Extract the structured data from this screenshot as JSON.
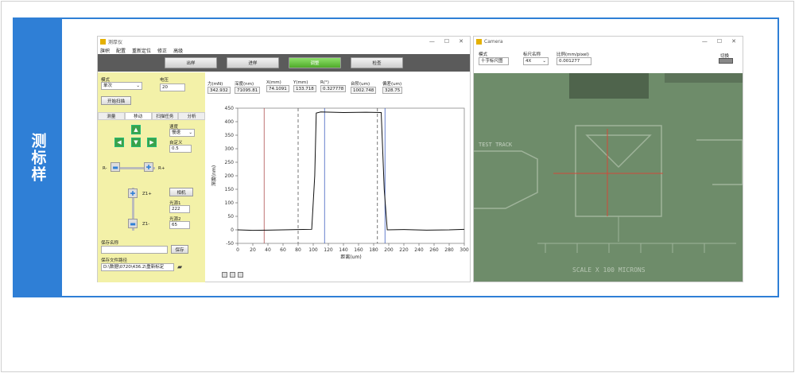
{
  "sidebar": {
    "title": "测标样"
  },
  "left_window": {
    "title": "测厚仪",
    "menu": [
      "旗帜",
      "配置",
      "重新定位",
      "修正",
      "高级"
    ],
    "toolbar": [
      "出样",
      "进样",
      "调整",
      "检查"
    ],
    "mode_label": "模式",
    "mode_value": "单次",
    "voltage_label": "电压",
    "voltage_value": "20",
    "start_scan": "开始扫描",
    "tabs": [
      "测量",
      "移动",
      "扫描任务",
      "分析"
    ],
    "speed_label": "速度",
    "speed_value": "慢速",
    "custom_label": "自定义",
    "custom_value": "0.5",
    "r_minus": "R-",
    "r_plus": "R+",
    "z_plus": "Z1+",
    "z_minus": "Z1-",
    "camera_btn": "相机",
    "light1_label": "光源1",
    "light1_value": "222",
    "light2_label": "光源2",
    "light2_value": "65",
    "save_name_label": "保存名称",
    "save_btn": "保存",
    "save_path_label": "保存文件路径",
    "save_path_value": "D:\\数据\\0720\\436.2\\重新标定",
    "readouts": [
      {
        "name": "力(mN)",
        "value": "342.932"
      },
      {
        "name": "深度(nm)",
        "value": "71095.81"
      },
      {
        "name": "X(mm)",
        "value": "74.1091"
      },
      {
        "name": "Y(mm)",
        "value": "133.718"
      },
      {
        "name": "R(°)",
        "value": "0.327778"
      },
      {
        "name": "台阶(um)",
        "value": "1002.748"
      },
      {
        "name": "偏差(um)",
        "value": "328.75"
      }
    ]
  },
  "chart_data": {
    "type": "line",
    "xlabel": "距离(um)",
    "ylabel": "深度(nm)",
    "xlim": [
      0,
      300
    ],
    "ylim": [
      -50,
      450
    ],
    "xticks": [
      0,
      20,
      40,
      60,
      80,
      100,
      120,
      140,
      160,
      180,
      200,
      220,
      240,
      260,
      280,
      300
    ],
    "yticks": [
      -50,
      0,
      50,
      100,
      150,
      200,
      250,
      300,
      350,
      400,
      450
    ],
    "grid": false,
    "series": [
      {
        "x": [
          0,
          20,
          40,
          60,
          80,
          98,
          102,
          104,
          110,
          140,
          170,
          190,
          194,
          198,
          220,
          250,
          280,
          300
        ],
        "y": [
          0,
          -2,
          -1,
          0,
          1,
          2,
          200,
          432,
          436,
          434,
          435,
          434,
          150,
          0,
          1,
          -1,
          0,
          2
        ]
      }
    ],
    "cursors": [
      {
        "x": 35,
        "style": "solid",
        "color": "#b05050"
      },
      {
        "x": 80,
        "style": "dashed",
        "color": "#555555"
      },
      {
        "x": 115,
        "style": "solid",
        "color": "#4060c0"
      },
      {
        "x": 185,
        "style": "dashed",
        "color": "#555555"
      },
      {
        "x": 195,
        "style": "solid",
        "color": "#4060c0"
      }
    ]
  },
  "right_window": {
    "title": "Camera",
    "mode_label": "模式",
    "mode_value": "十字标尺图",
    "ruler_label": "标尺名称",
    "ruler_value": "4X",
    "ratio_label": "比例(mm/pixel)",
    "ratio_value": "0.001277",
    "switch_label": "切换",
    "image_text1": "TEST TRACK",
    "image_text2": "SCALE X 100 MICRONS"
  }
}
